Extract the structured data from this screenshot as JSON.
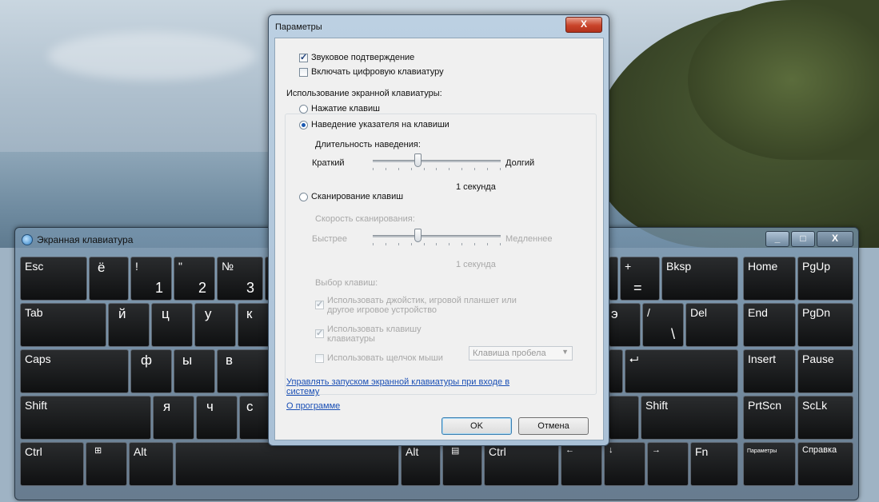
{
  "keyboard": {
    "title": "Экранная клавиатура",
    "controls": {
      "minimize": "_",
      "maximize": "□",
      "close": "X"
    },
    "keys": {
      "esc": "Esc",
      "yo": "ё",
      "k1_top": "!",
      "k1": "1",
      "k2_top": "\"",
      "k2": "2",
      "k3_top": "№",
      "k3": "3",
      "plus_top": "+",
      "plus": "=",
      "bksp": "Bksp",
      "home": "Home",
      "pgup": "PgUp",
      "tab": "Tab",
      "y": "й",
      "ts": "ц",
      "u": "у",
      "k": "к",
      "e_partial": "э",
      "slash_top": "/",
      "slash": "\\",
      "del": "Del",
      "end": "End",
      "pgdn": "PgDn",
      "caps": "Caps",
      "f": "ф",
      "yi": "ы",
      "v": "в",
      "enter": "⮠",
      "insert": "Insert",
      "pause": "Pause",
      "shift_l": "Shift",
      "ya": "я",
      "ch": "ч",
      "s": "с",
      "shift_r": "Shift",
      "prtscn": "PrtScn",
      "sclk": "ScLk",
      "ctrl_l": "Ctrl",
      "win": "⊞",
      "alt_l": "Alt",
      "alt_r": "Alt",
      "menu": "▤",
      "ctrl_r": "Ctrl",
      "left": "←",
      "down": "↓",
      "right": "→",
      "fn": "Fn",
      "params": "Параметры",
      "help": "Справка"
    }
  },
  "dialog": {
    "title": "Параметры",
    "close": "X",
    "sound_confirm": {
      "label": "Звуковое подтверждение",
      "checked": true
    },
    "numpad": {
      "label": "Включать цифровую клавиатуру",
      "checked": false
    },
    "usage_heading": "Использование экранной клавиатуры:",
    "mode_click": {
      "label": "Нажатие клавиш",
      "selected": false
    },
    "mode_hover": {
      "label": "Наведение указателя на клавиши",
      "selected": true
    },
    "hover_duration": {
      "label": "Длительность наведения:",
      "min": "Краткий",
      "max": "Долгий",
      "value_text": "1 секунда",
      "position": 0.35
    },
    "mode_scan": {
      "label": "Сканирование клавиш",
      "selected": false
    },
    "scan_speed": {
      "label": "Скорость сканирования:",
      "min": "Быстрее",
      "max": "Медленнее",
      "value_text": "1 секунда",
      "position": 0.35
    },
    "key_select_heading": "Выбор клавиш:",
    "use_joystick": {
      "label_line1": "Использовать джойстик, игровой планшет или",
      "label_line2": "другое игровое устройство",
      "checked": true
    },
    "use_key": {
      "label_line1": "Использовать клавишу",
      "label_line2": "клавиатуры",
      "checked": true
    },
    "key_combo": "Клавиша пробела",
    "use_mouse_click": {
      "label": "Использовать щелчок мыши",
      "checked": false
    },
    "link_startup_line1": "Управлять запуском экранной клавиатуры при входе в",
    "link_startup_line2": "систему",
    "link_about": "О программе",
    "ok": "OK",
    "cancel": "Отмена"
  }
}
